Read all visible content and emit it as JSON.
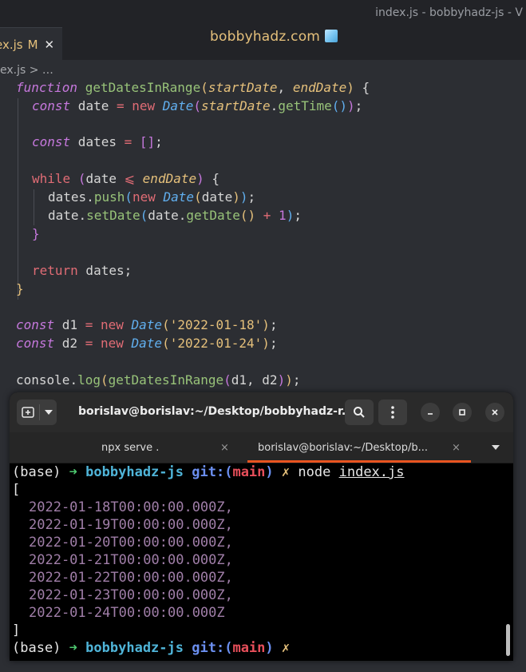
{
  "editor": {
    "window_title": "index.js - bobbyhadz-js - V",
    "brand": "bobbyhadz.com",
    "tab": {
      "filename": "ex.js",
      "modified": "M",
      "close": "✕"
    },
    "breadcrumb": "ex.js > …"
  },
  "code": {
    "l1": {
      "kw": "function",
      "name": "getDatesInRange",
      "p1": "(",
      "param1": "startDate",
      "comma": ", ",
      "param2": "endDate",
      "p1c": ")",
      "rest": " {"
    },
    "l2": {
      "kw": "const",
      "var": " date ",
      "eq": "=",
      "sp": " ",
      "new": "new",
      "cls": "Date",
      "p1": "(",
      "param": "startDate",
      "dot": ".",
      "fn": "getTime",
      "p2": "()",
      "p1c": ")",
      "semi": ";"
    },
    "l4": {
      "kw": "const",
      "var": " dates ",
      "eq": "=",
      "sp": " ",
      "arr": "[]",
      "semi": ";"
    },
    "l6": {
      "kw": "while",
      "sp": " ",
      "p1": "(",
      "var": "date ",
      "op": "⩽",
      "sp2": " ",
      "param": "endDate",
      "p1c": ")",
      "rest": " {"
    },
    "l7": {
      "obj": "dates",
      "dot": ".",
      "fn": "push",
      "p1": "(",
      "new": "new",
      "sp": " ",
      "cls": "Date",
      "p2": "(",
      "var": "date",
      "p2c": ")",
      "p1c": ")",
      "semi": ";"
    },
    "l8": {
      "obj": "date",
      "dot": ".",
      "fn": "setDate",
      "p1": "(",
      "obj2": "date",
      "dot2": ".",
      "fn2": "getDate",
      "p2": "()",
      "sp": " ",
      "plus": "+",
      "sp2": " ",
      "num": "1",
      "p1c": ")",
      "semi": ";"
    },
    "l9": {
      "brace": "}"
    },
    "l11": {
      "kw": "return",
      "rest": " dates;"
    },
    "l12": {
      "brace": "}"
    },
    "l14": {
      "kw": "const",
      "var": " d1 ",
      "eq": "=",
      "sp": " ",
      "new": "new",
      "sp2": " ",
      "cls": "Date",
      "p1": "(",
      "str": "'2022-01-18'",
      "p1c": ")",
      "semi": ";"
    },
    "l15": {
      "kw": "const",
      "var": " d2 ",
      "eq": "=",
      "sp": " ",
      "new": "new",
      "sp2": " ",
      "cls": "Date",
      "p1": "(",
      "str": "'2022-01-24'",
      "p1c": ")",
      "semi": ";"
    },
    "l17": {
      "obj": "console",
      "dot": ".",
      "fn": "log",
      "p1": "(",
      "fn2": "getDatesInRange",
      "p2": "(",
      "args": "d1, d2",
      "p2c": ")",
      "p1c": ")",
      "semi": ";"
    }
  },
  "terminal": {
    "title": "borislav@borislav:~/Desktop/bobbyhadz-r...",
    "tabs": [
      {
        "label": "npx serve .",
        "close": "×"
      },
      {
        "label": "borislav@borislav:~/Desktop/b...",
        "close": "×"
      }
    ],
    "prompt": {
      "base": "(base)",
      "arrow": "➜",
      "dir": "bobbyhadz-js",
      "git": "git:",
      "lp": "(",
      "branch": "main",
      "rp": ")",
      "dirty": "✗"
    },
    "command": {
      "cmd": "node",
      "arg": "index.js"
    },
    "open_bracket": "[",
    "dates": [
      "2022-01-18T00:00:00.000Z,",
      "2022-01-19T00:00:00.000Z,",
      "2022-01-20T00:00:00.000Z,",
      "2022-01-21T00:00:00.000Z,",
      "2022-01-22T00:00:00.000Z,",
      "2022-01-23T00:00:00.000Z,",
      "2022-01-24T00:00:00.000Z"
    ],
    "close_bracket": "]"
  }
}
